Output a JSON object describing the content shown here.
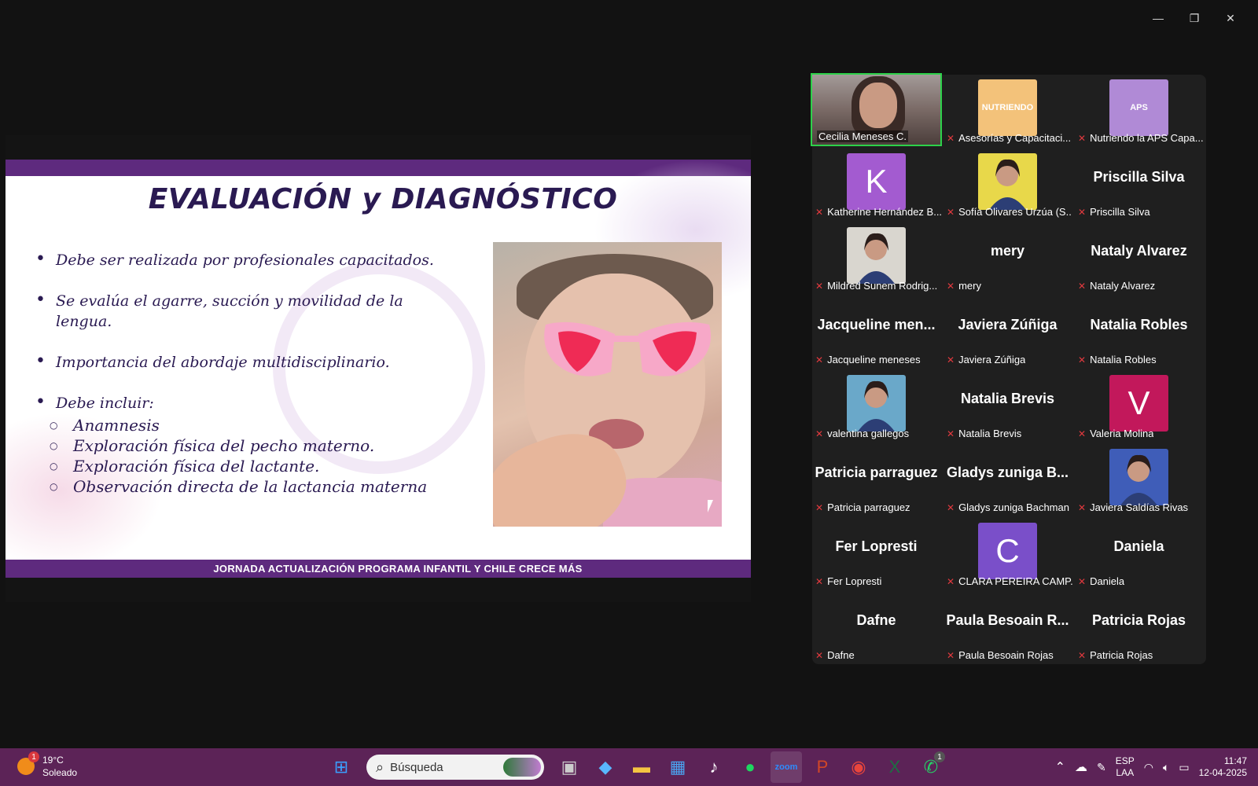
{
  "window": {
    "minimize_glyph": "—",
    "restore_glyph": "❐",
    "close_glyph": "✕"
  },
  "slide": {
    "title": "EVALUACIÓN y DIAGNÓSTICO",
    "bullets": [
      "Debe ser realizada por profesionales capacitados.",
      "Se evalúa el agarre, succión y movilidad de la lengua.",
      "Importancia del abordaje multidisciplinario.",
      "Debe incluir:"
    ],
    "subbullets": [
      "Anamnesis",
      "Exploración física del pecho materno.",
      "Exploración física del lactante.",
      "Observación directa de la lactancia materna"
    ],
    "footer": "JORNADA ACTUALIZACIÓN PROGRAMA INFANTIL Y CHILE CRECE MÁS"
  },
  "gallery": {
    "tiles": [
      {
        "label": "Cecilia Meneses C.",
        "kind": "camera",
        "active": true,
        "muted": false
      },
      {
        "label": "Asesorías y Capacitaci...",
        "kind": "logo",
        "logo_text": "NUTRIENDO",
        "color": "#f3c27a",
        "muted": true
      },
      {
        "label": "Nutriendo la APS Capa...",
        "kind": "logo",
        "logo_text": "APS",
        "color": "#b08ad6",
        "muted": true
      },
      {
        "label": "Katherine Hernández B...",
        "kind": "letter",
        "letter": "K",
        "color": "#a35bd0",
        "muted": true
      },
      {
        "label": "Sofía Olivares Urzúa (S...",
        "kind": "photo",
        "color": "#e8d84a",
        "muted": true
      },
      {
        "label": "Priscilla Silva",
        "kind": "name",
        "big": "Priscilla Silva",
        "muted": true
      },
      {
        "label": "Mildred Sunem Rodrig...",
        "kind": "photo",
        "color": "#d9d6cf",
        "muted": true
      },
      {
        "label": "mery",
        "kind": "name",
        "big": "mery",
        "muted": true
      },
      {
        "label": "Nataly Alvarez",
        "kind": "name",
        "big": "Nataly Alvarez",
        "muted": true
      },
      {
        "label": "Jacqueline meneses",
        "kind": "name",
        "big": "Jacqueline men...",
        "muted": true
      },
      {
        "label": "Javiera Zúñiga",
        "kind": "name",
        "big": "Javiera Zúñiga",
        "muted": true
      },
      {
        "label": "Natalia Robles",
        "kind": "name",
        "big": "Natalia Robles",
        "muted": true
      },
      {
        "label": "valentina gallegos",
        "kind": "photo",
        "color": "#6aa8c9",
        "muted": true
      },
      {
        "label": "Natalia Brevis",
        "kind": "name",
        "big": "Natalia Brevis",
        "muted": true
      },
      {
        "label": "Valeria Molina",
        "kind": "letter",
        "letter": "V",
        "color": "#c2185b",
        "muted": true
      },
      {
        "label": "Patricia parraguez",
        "kind": "name",
        "big": "Patricia parraguez",
        "muted": true
      },
      {
        "label": "Gladys zuniga Bachman",
        "kind": "name",
        "big": "Gladys zuniga B...",
        "muted": true
      },
      {
        "label": "Javiera Saldías Rivas",
        "kind": "photo",
        "color": "#3f5db8",
        "muted": true
      },
      {
        "label": "Fer Lopresti",
        "kind": "name",
        "big": "Fer Lopresti",
        "muted": true
      },
      {
        "label": "CLARA PEREIRA CAMP...",
        "kind": "letter",
        "letter": "C",
        "color": "#7a4fc9",
        "muted": true
      },
      {
        "label": "Daniela",
        "kind": "name",
        "big": "Daniela",
        "muted": true
      },
      {
        "label": "Dafne",
        "kind": "name",
        "big": "Dafne",
        "muted": true
      },
      {
        "label": "Paula Besoain Rojas",
        "kind": "name",
        "big": "Paula Besoain R...",
        "muted": true
      },
      {
        "label": "Patricia Rojas",
        "kind": "name",
        "big": "Patricia Rojas",
        "muted": true
      }
    ]
  },
  "taskbar": {
    "weather": {
      "temp": "19°C",
      "condition": "Soleado",
      "badge": "1"
    },
    "search_placeholder": "Búsqueda",
    "apps": [
      {
        "name": "windows-start-icon",
        "glyph": "⊞",
        "color": "#3aa0ff"
      },
      {
        "name": "search-icon",
        "glyph": "⌕",
        "color": "#333"
      },
      {
        "name": "task-view-icon",
        "glyph": "▣",
        "color": "#cccccc"
      },
      {
        "name": "copilot-icon",
        "glyph": "◆",
        "color": "#59b7ff"
      },
      {
        "name": "file-explorer-icon",
        "glyph": "▬",
        "color": "#f5c542"
      },
      {
        "name": "microsoft-store-icon",
        "glyph": "▦",
        "color": "#4aa3f0"
      },
      {
        "name": "tiktok-icon",
        "glyph": "♪",
        "color": "#ffffff"
      },
      {
        "name": "spotify-icon",
        "glyph": "●",
        "color": "#1ed760"
      },
      {
        "name": "zoom-icon",
        "glyph": "zoom",
        "color": "#2d8cff"
      },
      {
        "name": "powerpoint-icon",
        "glyph": "P",
        "color": "#d24726"
      },
      {
        "name": "chrome-icon",
        "glyph": "◉",
        "color": "#e8453c"
      },
      {
        "name": "excel-icon",
        "glyph": "X",
        "color": "#1d6f42"
      },
      {
        "name": "whatsapp-icon",
        "glyph": "✆",
        "color": "#25d366",
        "badge": "1"
      }
    ],
    "tray": {
      "chevron": "⌃",
      "lang_top": "ESP",
      "lang_bottom": "LAA",
      "time": "11:47",
      "date": "12-04-2025"
    }
  }
}
